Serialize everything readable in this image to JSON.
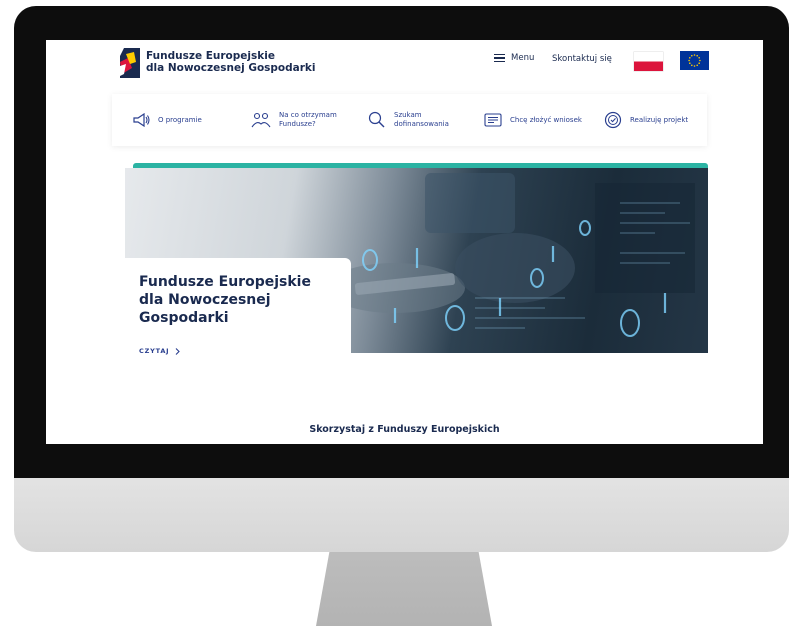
{
  "site": {
    "logo_line1": "Fundusze Europejskie",
    "logo_line2": "dla Nowoczesnej Gospodarki",
    "menu_label": "Menu",
    "contact_label": "Skontaktuj się"
  },
  "nav": {
    "items": [
      {
        "label": "O programie",
        "icon": "megaphone-icon"
      },
      {
        "label": "Na co otrzymam\nFundusze?",
        "icon": "people-icon"
      },
      {
        "label": "Szukam\ndofinansowania",
        "icon": "magnifier-icon"
      },
      {
        "label": "Chcę złożyć wniosek",
        "icon": "document-icon"
      },
      {
        "label": "Realizuję projekt",
        "icon": "target-icon"
      }
    ]
  },
  "hero": {
    "title": "Fundusze Europejskie\ndla Nowoczesnej\nGospodarki",
    "link_label": "CZYTAJ",
    "link_icon": "chevron-right-icon"
  },
  "section": {
    "heading": "Skorzystaj z Funduszy Europejskich"
  },
  "colors": {
    "brand_navy": "#1a2a4f",
    "nav_blue": "#2a3f8f",
    "accent_teal": "#2bb3a3",
    "pl_red": "#dc143c",
    "eu_blue": "#003399",
    "eu_star": "#ffcc00"
  }
}
